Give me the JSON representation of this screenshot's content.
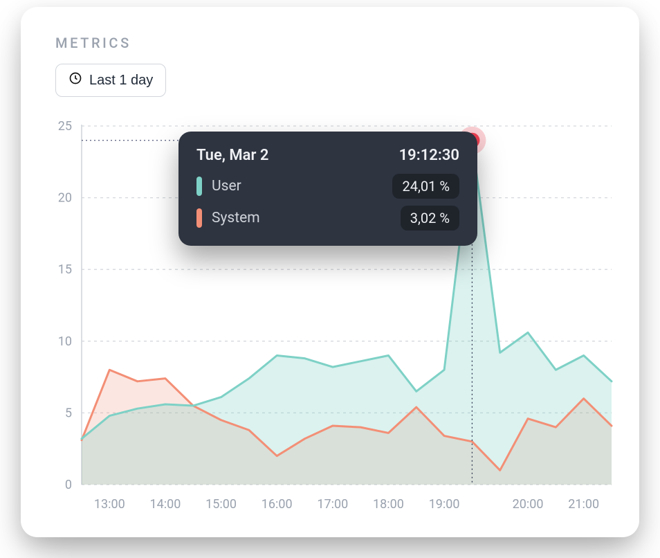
{
  "card": {
    "title": "METRICS",
    "range_label": "Last 1 day"
  },
  "tooltip": {
    "date": "Tue, Mar 2",
    "time": "19:12:30",
    "rows": [
      {
        "name": "User",
        "value": "24,01 %",
        "swatch": "sw-user"
      },
      {
        "name": "System",
        "value": "3,02 %",
        "swatch": "sw-system"
      }
    ]
  },
  "chart_data": {
    "type": "area",
    "title": "",
    "xlabel": "",
    "ylabel": "",
    "ylim": [
      0,
      25
    ],
    "y_ticks": [
      0,
      5,
      10,
      15,
      20,
      25
    ],
    "x_tick_labels": [
      "13:00",
      "14:00",
      "15:00",
      "16:00",
      "17:00",
      "18:00",
      "19:00",
      "20:00",
      "21:00"
    ],
    "x": [
      "12:30",
      "13:00",
      "13:30",
      "14:00",
      "14:30",
      "15:00",
      "15:30",
      "16:00",
      "16:30",
      "17:00",
      "17:30",
      "18:00",
      "18:30",
      "19:00",
      "19:12",
      "19:30",
      "20:00",
      "20:30",
      "21:00",
      "21:30"
    ],
    "series": [
      {
        "name": "User",
        "values": [
          3.2,
          4.8,
          5.3,
          5.6,
          5.5,
          6.1,
          7.4,
          9.0,
          8.8,
          8.2,
          8.6,
          9.0,
          6.5,
          8.0,
          24.0,
          9.2,
          10.6,
          8.0,
          9.0,
          7.2
        ]
      },
      {
        "name": "System",
        "values": [
          3.1,
          8.0,
          7.2,
          7.4,
          5.5,
          4.5,
          3.8,
          2.0,
          3.2,
          4.1,
          4.0,
          3.6,
          5.4,
          3.4,
          3.0,
          1.0,
          4.6,
          4.0,
          6.0,
          4.1
        ]
      }
    ],
    "highlight": {
      "x": "19:12",
      "y": 24.0
    },
    "legend": [
      "User",
      "System"
    ]
  },
  "colors": {
    "user": "#7ed1c6",
    "system": "#f38f76",
    "marker": "#ed4152"
  }
}
